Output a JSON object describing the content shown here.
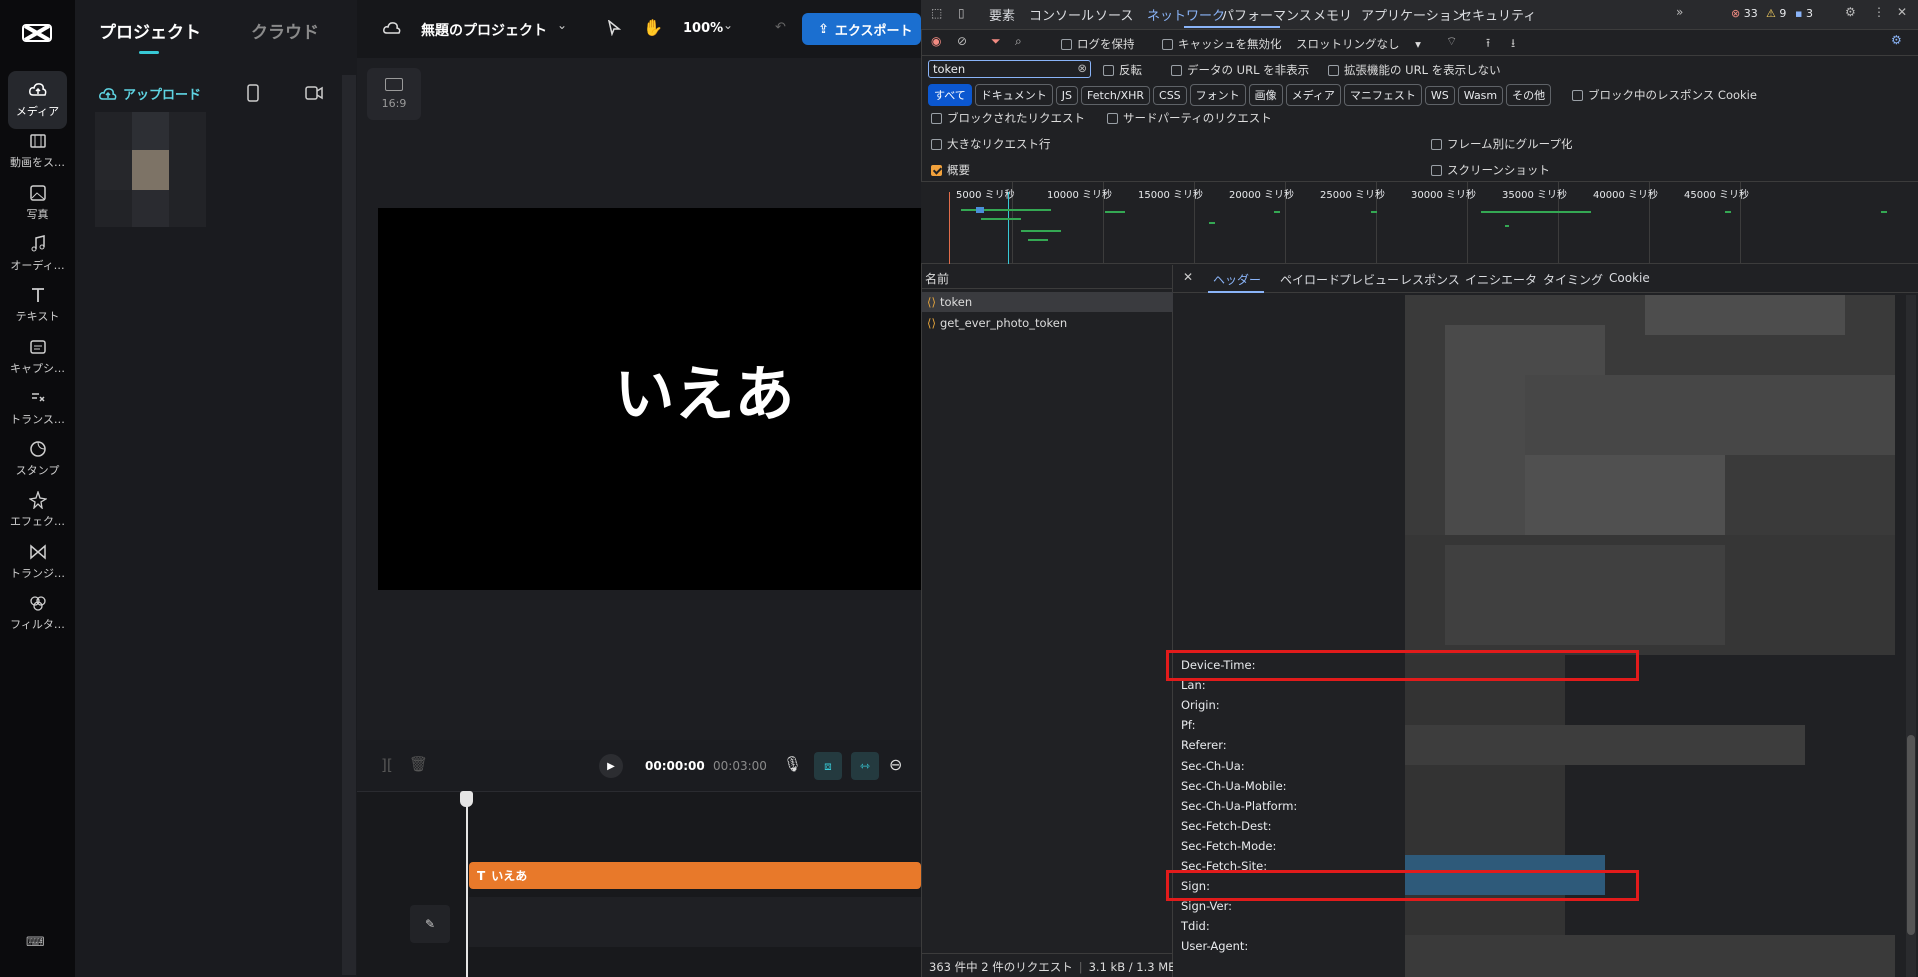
{
  "app": {
    "rail": [
      {
        "label": "メディア",
        "icon": "cloud-upload-icon",
        "active": true
      },
      {
        "label": "動画をス…",
        "icon": "film-icon"
      },
      {
        "label": "写真",
        "icon": "image-icon"
      },
      {
        "label": "オーディ…",
        "icon": "music-icon"
      },
      {
        "label": "テキスト",
        "icon": "text-icon"
      },
      {
        "label": "キャプシ…",
        "icon": "caption-icon"
      },
      {
        "label": "トランス…",
        "icon": "transcript-icon"
      },
      {
        "label": "スタンプ",
        "icon": "sticker-icon"
      },
      {
        "label": "エフェク…",
        "icon": "effects-icon"
      },
      {
        "label": "トランジ…",
        "icon": "transition-icon"
      },
      {
        "label": "フィルタ…",
        "icon": "filter-icon"
      }
    ],
    "panel": {
      "tab_project": "プロジェクト",
      "tab_cloud": "クラウド",
      "upload": "アップロード"
    },
    "topbar": {
      "project_name": "無題のプロジェクト",
      "zoom": "100%",
      "export": "エクスポート"
    },
    "ratio": "16:9",
    "canvas_text": "いえあ",
    "timeline": {
      "current": "00:00:00",
      "total": "00:03:00",
      "clip_text": "いえあ"
    }
  },
  "devtools": {
    "tabs": [
      "要素",
      "コンソール",
      "ソース",
      "ネットワーク",
      "パフォーマンス",
      "メモリ",
      "アプリケーション",
      "セキュリティ"
    ],
    "active_tab": "ネットワーク",
    "counts": {
      "errors": "33",
      "warnings": "9",
      "info": "3"
    },
    "toolbar": {
      "preserve_log": "ログを保持",
      "disable_cache": "キャッシュを無効化",
      "throttle": "スロットリングなし"
    },
    "filter": {
      "value": "token",
      "invert": "反転",
      "hide_data_urls": "データの URL を非表示",
      "hide_ext_urls": "拡張機能の URL を表示しない"
    },
    "types": [
      "すべて",
      "ドキュメント",
      "JS",
      "Fetch/XHR",
      "CSS",
      "フォント",
      "画像",
      "メディア",
      "マニフェスト",
      "WS",
      "Wasm",
      "その他"
    ],
    "blocked_cookies": "ブロック中のレスポンス Cookie",
    "blocked_requests": "ブロックされたリクエスト",
    "third_party": "サードパーティのリクエスト",
    "big_rows": "大きなリクエスト行",
    "group_by_frame": "フレーム別にグループ化",
    "overview": "概要",
    "screenshots": "スクリーンショット",
    "ticks": [
      "5000 ミリ秒",
      "10000 ミリ秒",
      "15000 ミリ秒",
      "20000 ミリ秒",
      "25000 ミリ秒",
      "30000 ミリ秒",
      "35000 ミリ秒",
      "40000 ミリ秒",
      "45000 ミリ秒"
    ],
    "name_header": "名前",
    "requests": [
      "token",
      "get_ever_photo_token"
    ],
    "detail_tabs": [
      "ヘッダー",
      "ペイロード",
      "プレビュー",
      "レスポンス",
      "イニシエータ",
      "タイミング",
      "Cookie"
    ],
    "headers": [
      "Device-Time:",
      "Lan:",
      "Origin:",
      "Pf:",
      "Referer:",
      "Sec-Ch-Ua:",
      "Sec-Ch-Ua-Mobile:",
      "Sec-Ch-Ua-Platform:",
      "Sec-Fetch-Dest:",
      "Sec-Fetch-Mode:",
      "Sec-Fetch-Site:",
      "Sign:",
      "Sign-Ver:",
      "Tdid:",
      "User-Agent:"
    ],
    "status": {
      "requests": "363 件中 2 件のリクエスト",
      "size": "3.1 kB / 1.3 ME"
    }
  }
}
